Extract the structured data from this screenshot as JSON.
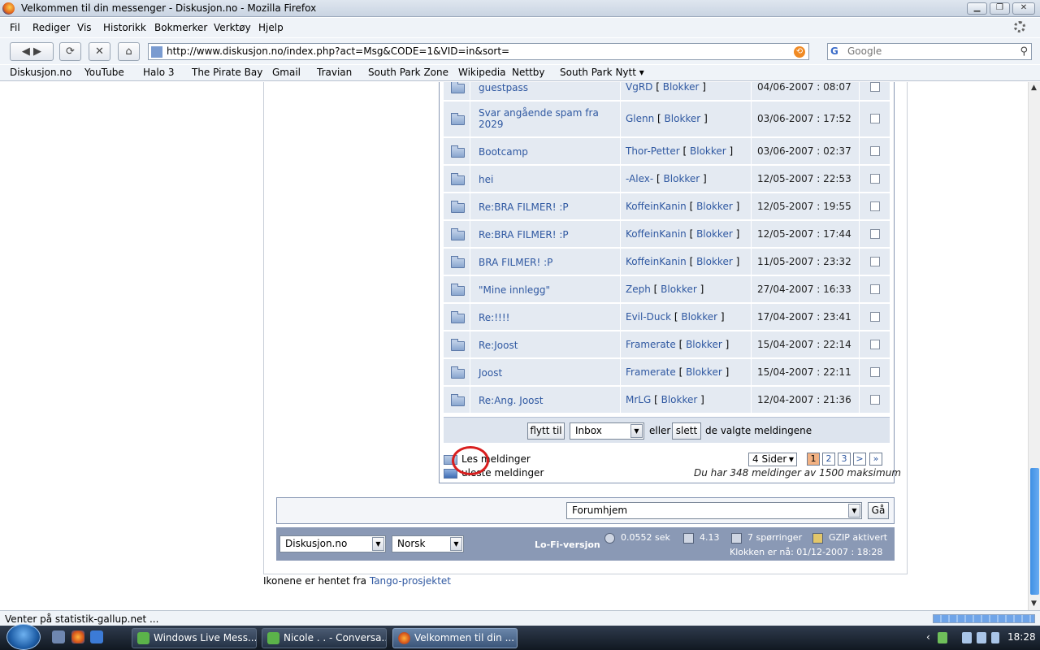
{
  "window": {
    "title": "Velkommen til din messenger - Diskusjon.no - Mozilla Firefox"
  },
  "menu": [
    "Fil",
    "Rediger",
    "Vis",
    "Historikk",
    "Bokmerker",
    "Verktøy",
    "Hjelp"
  ],
  "nav": {
    "url": "http://www.diskusjon.no/index.php?act=Msg&CODE=1&VID=in&sort=",
    "search_placeholder": "Google"
  },
  "bookmarks": [
    "Diskusjon.no",
    "YouTube",
    "Halo 3",
    "The Pirate Bay",
    "Gmail",
    "Travian",
    "South Park Zone",
    "Wikipedia",
    "Nettby",
    "South Park Nytt"
  ],
  "messages": [
    {
      "subject": "guestpass",
      "sender": "VgRD",
      "date": "04/06-2007 : 08:07"
    },
    {
      "subject": "Svar angående spam fra 2029",
      "sender": "Glenn",
      "date": "03/06-2007 : 17:52"
    },
    {
      "subject": "Bootcamp",
      "sender": "Thor-Petter",
      "date": "03/06-2007 : 02:37"
    },
    {
      "subject": "hei",
      "sender": "-Alex-",
      "date": "12/05-2007 : 22:53"
    },
    {
      "subject": "Re:BRA FILMER! :P",
      "sender": "KoffeinKanin",
      "date": "12/05-2007 : 19:55"
    },
    {
      "subject": "Re:BRA FILMER! :P",
      "sender": "KoffeinKanin",
      "date": "12/05-2007 : 17:44"
    },
    {
      "subject": "BRA FILMER! :P",
      "sender": "KoffeinKanin",
      "date": "11/05-2007 : 23:32"
    },
    {
      "subject": "\"Mine innlegg\"",
      "sender": "Zeph",
      "date": "27/04-2007 : 16:33"
    },
    {
      "subject": "Re:!!!!",
      "sender": "Evil-Duck",
      "date": "17/04-2007 : 23:41"
    },
    {
      "subject": "Re:Joost",
      "sender": "Framerate",
      "date": "15/04-2007 : 22:14"
    },
    {
      "subject": "Joost",
      "sender": "Framerate",
      "date": "15/04-2007 : 22:11"
    },
    {
      "subject": "Re:Ang. Joost",
      "sender": "MrLG",
      "date": "12/04-2007 : 21:36"
    }
  ],
  "block_label": "Blokker",
  "actions": {
    "move_button": "flytt til",
    "folder_select": "Inbox",
    "or_text": "eller",
    "delete_button": "slett",
    "suffix_text": "de valgte meldingene"
  },
  "legend": {
    "read": "Les meldinger",
    "unread": "uleste meldinger"
  },
  "pagination": {
    "pages_select": "4 Sider",
    "pages": [
      "1",
      "2",
      "3",
      ">",
      "»"
    ],
    "current": "1",
    "count_text": "Du har 348 meldinger av 1500 maksimum"
  },
  "jump": {
    "select": "Forumhjem",
    "go_button": "Gå"
  },
  "footer": {
    "site_select": "Diskusjon.no",
    "lang_select": "Norsk",
    "lofi": "Lo-Fi-versjon",
    "time": "0.0552 sek",
    "load": "4.13",
    "queries": "7 spørringer",
    "gzip": "GZIP aktivert",
    "clock": "Klokken er nå: 01/12-2007 : 18:28"
  },
  "credits": {
    "text": "Ikonene er hentet fra ",
    "link": "Tango-prosjektet"
  },
  "status": "Venter på statistik-gallup.net ...",
  "taskbar": {
    "tasks": [
      "Windows Live Mess...",
      "Nicole . . - Conversa...",
      "Velkommen til din ..."
    ],
    "clock": "18:28"
  }
}
